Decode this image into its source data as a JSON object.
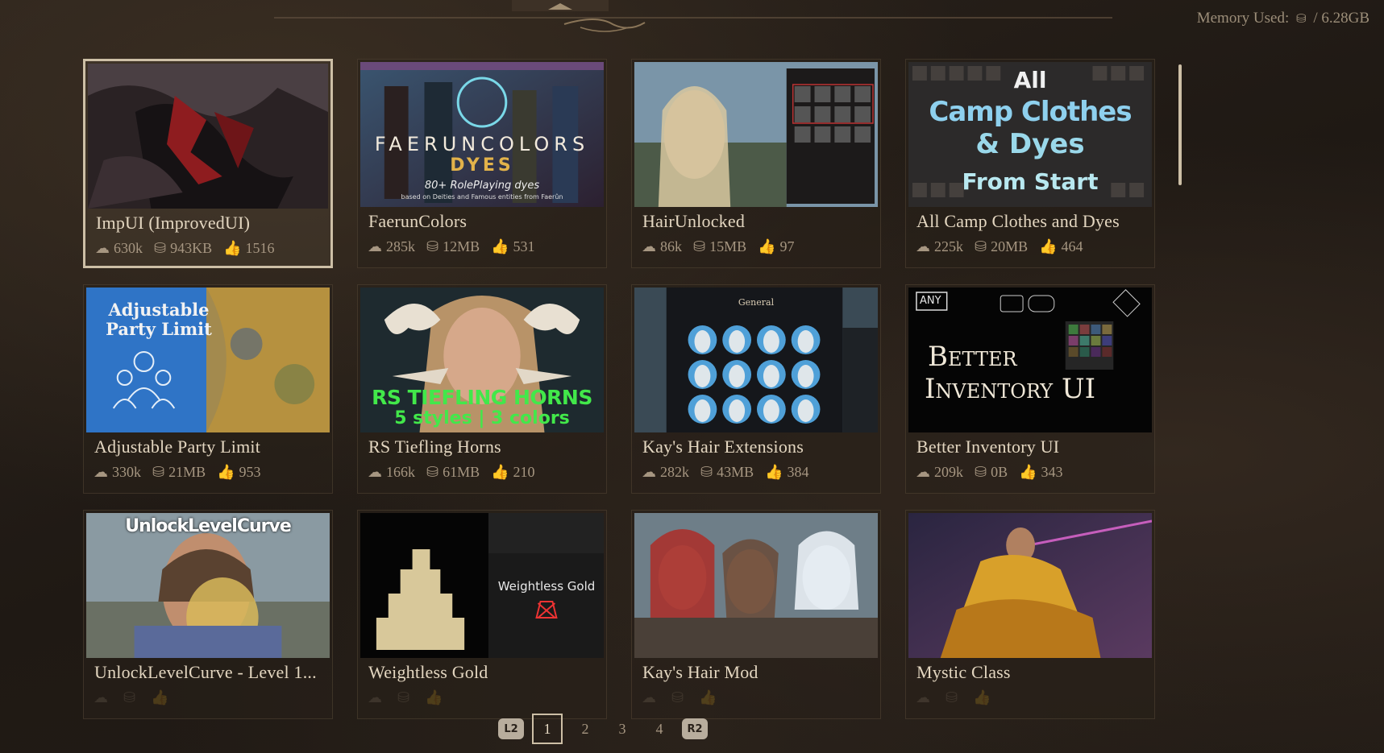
{
  "header": {
    "memory_label": "Memory Used:",
    "memory_value": "/ 6.28GB"
  },
  "mods": [
    {
      "title": "ImpUI (ImprovedUI)",
      "downloads": "630k",
      "size": "943KB",
      "likes": "1516",
      "selected": true
    },
    {
      "title": "FaerunColors",
      "downloads": "285k",
      "size": "12MB",
      "likes": "531",
      "thumb_text": [
        "FAERUNCOLORS",
        "DYES",
        "80+ RolePlaying dyes",
        "based on Deities and Famous entities from Faerûn"
      ]
    },
    {
      "title": "HairUnlocked",
      "downloads": "86k",
      "size": "15MB",
      "likes": "97"
    },
    {
      "title": "All Camp Clothes and Dyes",
      "downloads": "225k",
      "size": "20MB",
      "likes": "464",
      "thumb_text": [
        "All",
        "Camp Clothes",
        "& Dyes",
        "From Start"
      ]
    },
    {
      "title": "Adjustable Party Limit",
      "downloads": "330k",
      "size": "21MB",
      "likes": "953",
      "thumb_text": [
        "Adjustable",
        "Party Limit"
      ]
    },
    {
      "title": "RS Tiefling Horns",
      "downloads": "166k",
      "size": "61MB",
      "likes": "210",
      "thumb_text": [
        "RS TIEFLING HORNS",
        "5 styles | 3 colors"
      ]
    },
    {
      "title": "Kay's Hair Extensions",
      "downloads": "282k",
      "size": "43MB",
      "likes": "384",
      "thumb_text": [
        "General"
      ]
    },
    {
      "title": "Better Inventory UI",
      "downloads": "209k",
      "size": "0B",
      "likes": "343",
      "thumb_text": [
        "ANY",
        "Better",
        "Inventory UI"
      ]
    },
    {
      "title": "UnlockLevelCurve - Level 1...",
      "downloads": "",
      "size": "",
      "likes": "",
      "thumb_text": [
        "UnlockLevelCurve"
      ]
    },
    {
      "title": "Weightless Gold",
      "downloads": "",
      "size": "",
      "likes": "",
      "thumb_text": [
        "Weightless Gold"
      ]
    },
    {
      "title": "Kay's Hair Mod",
      "downloads": "",
      "size": "",
      "likes": "",
      "thumb_text": []
    },
    {
      "title": "Mystic Class",
      "downloads": "",
      "size": "",
      "likes": "",
      "thumb_text": []
    }
  ],
  "pagination": {
    "prev_button": "L2",
    "pages": [
      "1",
      "2",
      "3",
      "4"
    ],
    "current_page": 1,
    "next_button": "R2"
  },
  "colors": {
    "accent": "#cdbfa6",
    "background": "#241d17",
    "title_text": "#e3d6c0",
    "stat_text": "#a69681"
  }
}
